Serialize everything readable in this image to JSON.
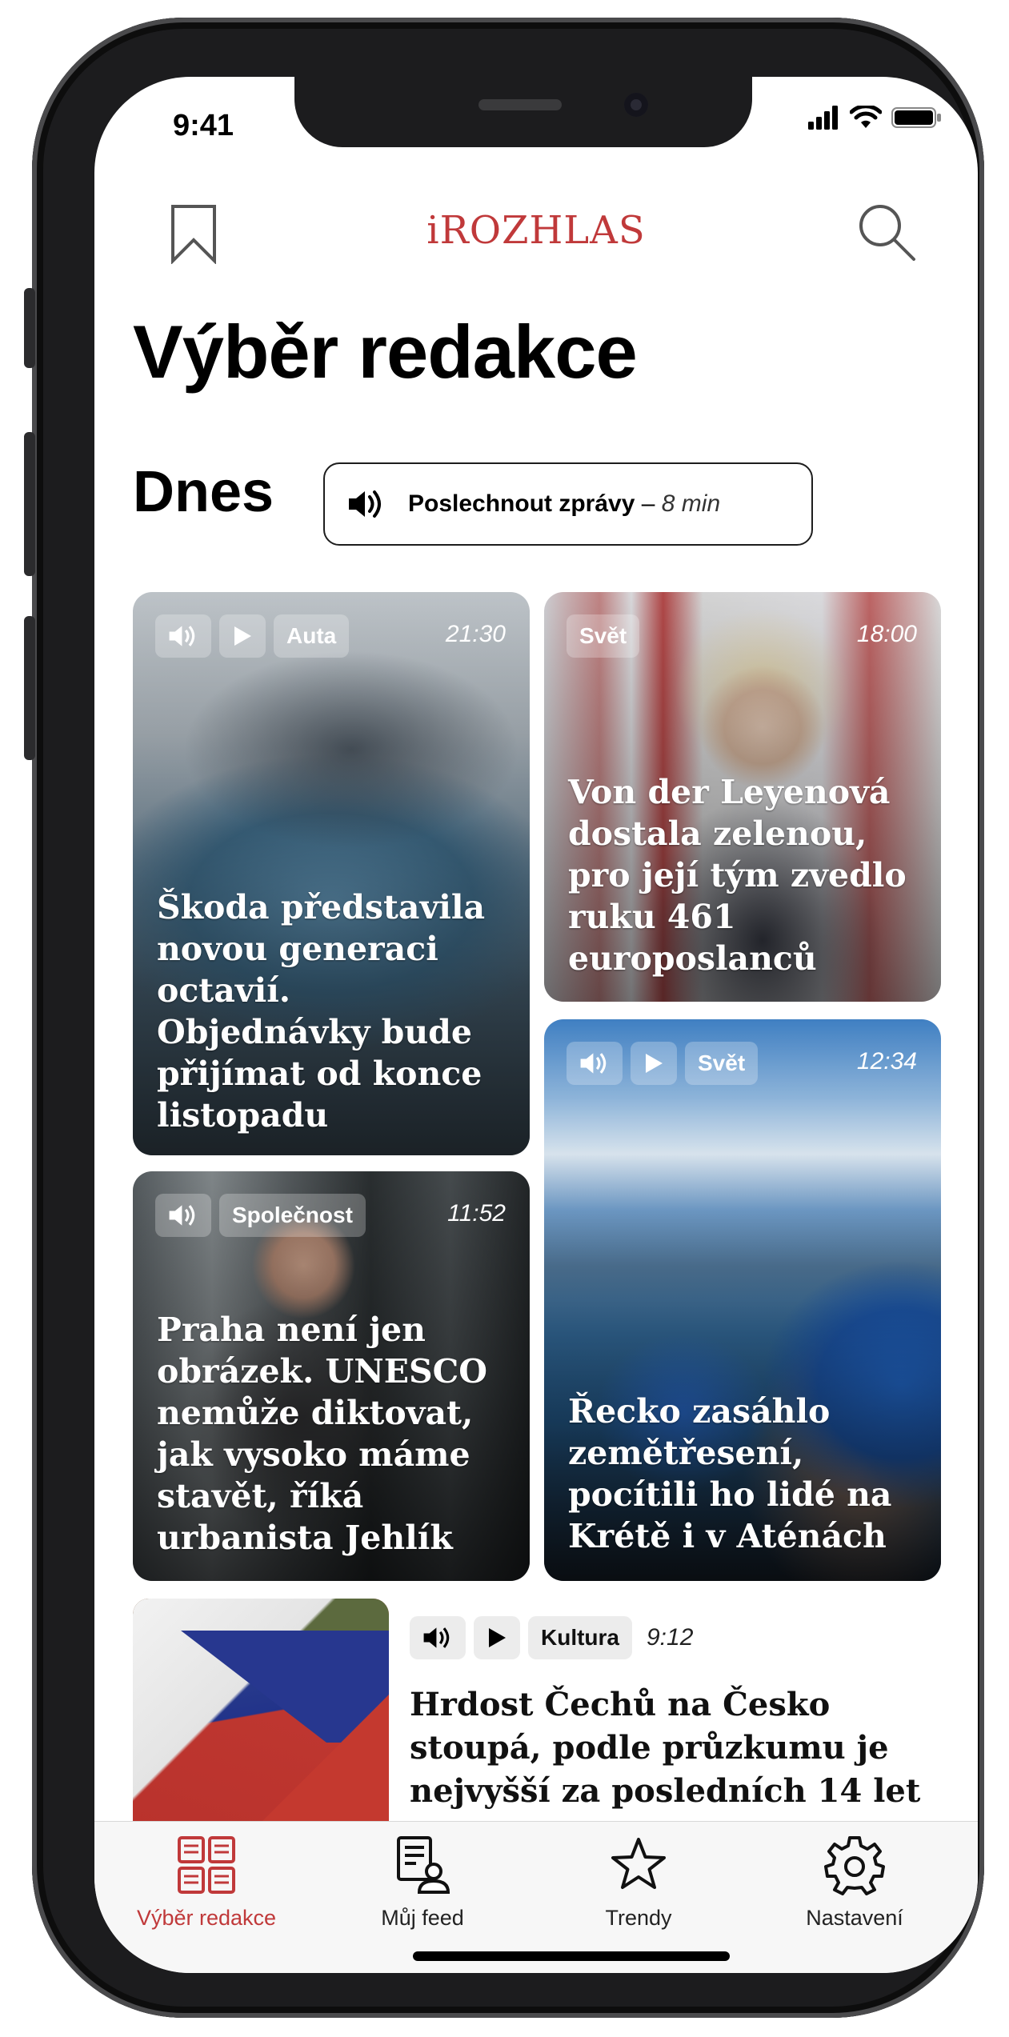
{
  "status": {
    "time": "9:41"
  },
  "header": {
    "logo": "iROZHLAS"
  },
  "page": {
    "title": "Výběr redakce",
    "section": "Dnes"
  },
  "listen_button": {
    "label": "Poslechnout zprávy",
    "separator": " – ",
    "duration": "8 min"
  },
  "cards": [
    {
      "category": "Auta",
      "time": "21:30",
      "headline": "Škoda představila novou generaci octavií. Objednávky bude přijímat od konce listopadu"
    },
    {
      "category": "Svět",
      "time": "18:00",
      "headline": "Von der Leyenová dostala zelenou, pro její tým zvedlo ruku 461 europoslanců"
    },
    {
      "category": "Společnost",
      "time": "11:52",
      "headline": "Praha není jen obrázek. UNESCO nemůže diktovat, jak vysoko máme stavět, říká urbanista Jehlík"
    },
    {
      "category": "Svět",
      "time": "12:34",
      "headline": "Řecko zasáhlo zemětřesení, pocítili ho lidé na Krétě i v Aténách"
    }
  ],
  "list_item": {
    "category": "Kultura",
    "time": "9:12",
    "headline": "Hrdost Čechů na Česko stoupá, podle průzkumu je nejvyšší za posledních 14 let"
  },
  "tabs": [
    {
      "label": "Výběr redakce",
      "icon": "grid-icon",
      "active": true
    },
    {
      "label": "Můj feed",
      "icon": "feed-icon"
    },
    {
      "label": "Trendy",
      "icon": "star-icon"
    },
    {
      "label": "Nastavení",
      "icon": "gear-icon"
    }
  ],
  "colors": {
    "accent": "#c0393a",
    "text": "#111111",
    "tabbar": "#f7f7f7"
  }
}
